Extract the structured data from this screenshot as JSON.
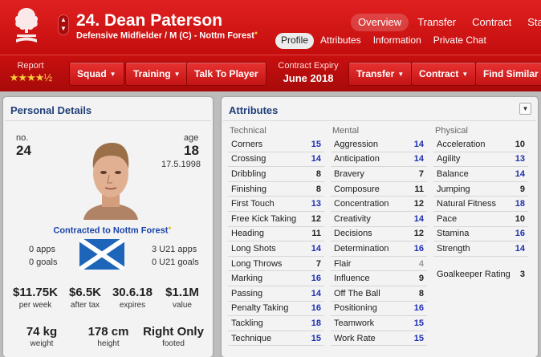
{
  "header": {
    "player_name": "24. Dean Paterson",
    "player_sub": "Defensive Midfielder / M (C) - Nottm Forest",
    "top_tabs": [
      {
        "label": "Overview",
        "active": true
      },
      {
        "label": "Transfer",
        "active": false
      },
      {
        "label": "Contract",
        "active": false
      },
      {
        "label": "Stats",
        "active": false
      }
    ],
    "sub_tabs": [
      {
        "label": "Profile",
        "active": true
      },
      {
        "label": "Attributes",
        "active": false
      },
      {
        "label": "Information",
        "active": false
      },
      {
        "label": "Private Chat",
        "active": false
      }
    ],
    "stepper_up": "▲",
    "stepper_down": "▼"
  },
  "toolbar": {
    "report_label": "Report",
    "report_stars": 4.5,
    "report_stars_text": "★★★★½",
    "squad": "Squad",
    "training": "Training",
    "talk": "Talk To Player",
    "contract_label": "Contract Expiry",
    "contract_date": "June 2018",
    "transfer": "Transfer",
    "contract": "Contract",
    "find_similar": "Find Similar P",
    "caret": "▼"
  },
  "personal": {
    "title": "Personal Details",
    "no_label": "no.",
    "no_value": "24",
    "age_label": "age",
    "age_value": "18",
    "dob": "17.5.1998",
    "contracted": "Contracted to Nottm Forest",
    "apps": "0 apps",
    "goals": "0 goals",
    "u21_apps": "3 U21 apps",
    "u21_goals": "0 U21 goals",
    "wage": "$11.75K",
    "wage_label": "per week",
    "after_tax": "$6.5K",
    "after_tax_label": "after tax",
    "expires": "30.6.18",
    "expires_label": "expires",
    "value": "$1.1M",
    "value_label": "value",
    "weight": "74 kg",
    "weight_label": "weight",
    "height": "178 cm",
    "height_label": "height",
    "footed": "Right Only",
    "footed_label": "footed"
  },
  "attributes": {
    "title": "Attributes",
    "technical_label": "Technical",
    "mental_label": "Mental",
    "physical_label": "Physical",
    "technical": [
      {
        "name": "Corners",
        "value": "15"
      },
      {
        "name": "Crossing",
        "value": "14"
      },
      {
        "name": "Dribbling",
        "value": "8"
      },
      {
        "name": "Finishing",
        "value": "8"
      },
      {
        "name": "First Touch",
        "value": "13"
      },
      {
        "name": "Free Kick Taking",
        "value": "12"
      },
      {
        "name": "Heading",
        "value": "11"
      },
      {
        "name": "Long Shots",
        "value": "14"
      },
      {
        "name": "Long Throws",
        "value": "7"
      },
      {
        "name": "Marking",
        "value": "16"
      },
      {
        "name": "Passing",
        "value": "14"
      },
      {
        "name": "Penalty Taking",
        "value": "16"
      },
      {
        "name": "Tackling",
        "value": "18"
      },
      {
        "name": "Technique",
        "value": "15"
      }
    ],
    "mental": [
      {
        "name": "Aggression",
        "value": "14"
      },
      {
        "name": "Anticipation",
        "value": "14"
      },
      {
        "name": "Bravery",
        "value": "7"
      },
      {
        "name": "Composure",
        "value": "11"
      },
      {
        "name": "Concentration",
        "value": "12"
      },
      {
        "name": "Creativity",
        "value": "14"
      },
      {
        "name": "Decisions",
        "value": "12"
      },
      {
        "name": "Determination",
        "value": "16"
      },
      {
        "name": "Flair",
        "value": "4"
      },
      {
        "name": "Influence",
        "value": "9"
      },
      {
        "name": "Off The Ball",
        "value": "8"
      },
      {
        "name": "Positioning",
        "value": "16"
      },
      {
        "name": "Teamwork",
        "value": "15"
      },
      {
        "name": "Work Rate",
        "value": "15"
      }
    ],
    "physical": [
      {
        "name": "Acceleration",
        "value": "10"
      },
      {
        "name": "Agility",
        "value": "13"
      },
      {
        "name": "Balance",
        "value": "14"
      },
      {
        "name": "Jumping",
        "value": "9"
      },
      {
        "name": "Natural Fitness",
        "value": "18"
      },
      {
        "name": "Pace",
        "value": "10"
      },
      {
        "name": "Stamina",
        "value": "16"
      },
      {
        "name": "Strength",
        "value": "14"
      }
    ],
    "goalkeeper_label": "Goalkeeper Rating",
    "goalkeeper_value": "3",
    "menu_caret": "▼"
  },
  "colors": {
    "header_red": "#d01414",
    "title_blue": "#213f7a",
    "high_value_blue": "#1c2fb0",
    "star_gold": "#f4cf3b"
  },
  "icons": {
    "crest": "nottm-forest-crest-icon",
    "flag": "scotland-flag-icon",
    "face": "player-face-icon"
  }
}
